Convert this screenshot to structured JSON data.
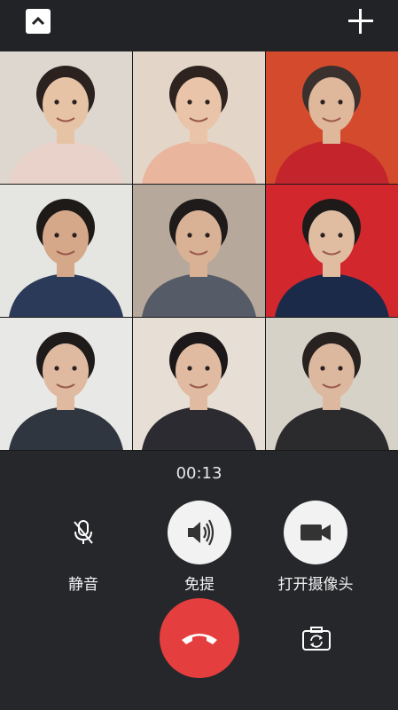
{
  "call": {
    "timer": "00:13",
    "controls": {
      "mute_label": "静音",
      "speaker_label": "免提",
      "camera_label": "打开摄像头"
    }
  },
  "participants": [
    {
      "name": "",
      "bg": "#ddd7cf",
      "skin": "#e7c3a6",
      "hair": "#2b2220",
      "shirt": "#e9d2c9"
    },
    {
      "name": "",
      "bg": "#e3d6c8",
      "skin": "#e9c4a8",
      "hair": "#2f2320",
      "shirt": "#e9b59d"
    },
    {
      "name": "",
      "bg": "#d34b2c",
      "skin": "#dfb79a",
      "hair": "#3a302d",
      "shirt": "#c4242c"
    },
    {
      "name": "",
      "bg": "#e5e5e2",
      "skin": "#d6a88a",
      "hair": "#1e1a18",
      "shirt": "#2c3a5a"
    },
    {
      "name": "",
      "bg": "#b6a89a",
      "skin": "#d9b296",
      "hair": "#1e1b1a",
      "shirt": "#555b67"
    },
    {
      "name": "",
      "bg": "#d3272e",
      "skin": "#e0bda1",
      "hair": "#1d1a19",
      "shirt": "#1c2a49"
    },
    {
      "name": "",
      "bg": "#e8e9e6",
      "skin": "#dfbaa0",
      "hair": "#1f1b1a",
      "shirt": "#30363f"
    },
    {
      "name": "",
      "bg": "#e7dfd6",
      "skin": "#e0bba1",
      "hair": "#1c1718",
      "shirt": "#2b2b31"
    },
    {
      "name": "",
      "bg": "#d7d2c7",
      "skin": "#dcb89e",
      "hair": "#27211f",
      "shirt": "#2b2b2e"
    }
  ]
}
